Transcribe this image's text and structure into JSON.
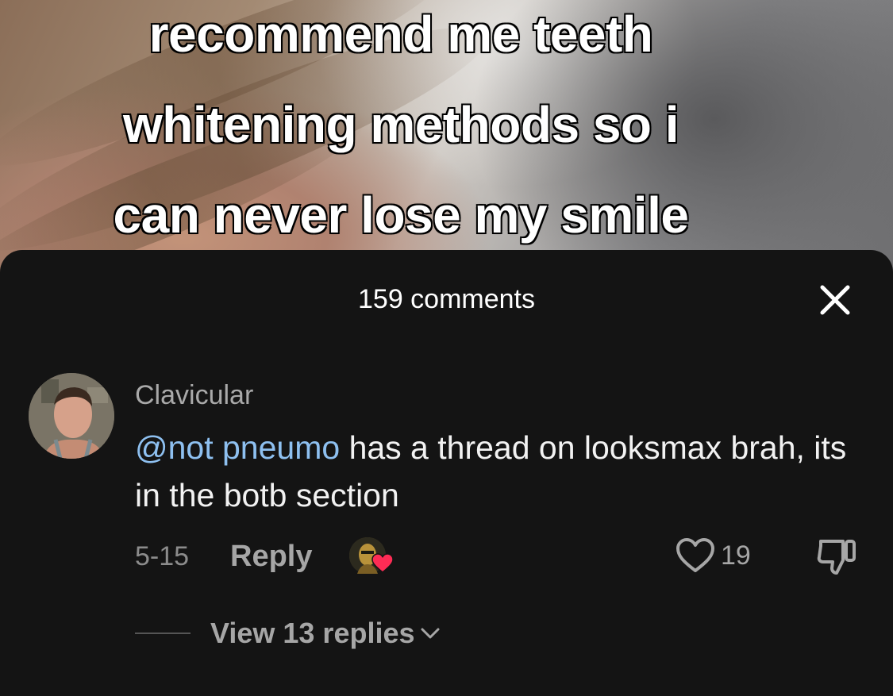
{
  "video": {
    "caption_lines": [
      "recommend me teeth",
      "whitening methods so i",
      "can never lose my smile"
    ]
  },
  "sheet": {
    "title": "159 comments",
    "close_icon": "close-icon"
  },
  "comment": {
    "username": "Clavicular",
    "mention": "@not pneumo",
    "text": " has a thread on looksmax brah, its in the botb section",
    "date": "5-15",
    "reply_label": "Reply",
    "like_count": "19",
    "view_replies_label": "View 13 replies"
  },
  "colors": {
    "sheet_bg": "#141414",
    "mention": "#8ec0f0",
    "creator_heart": "#fe2c55"
  }
}
